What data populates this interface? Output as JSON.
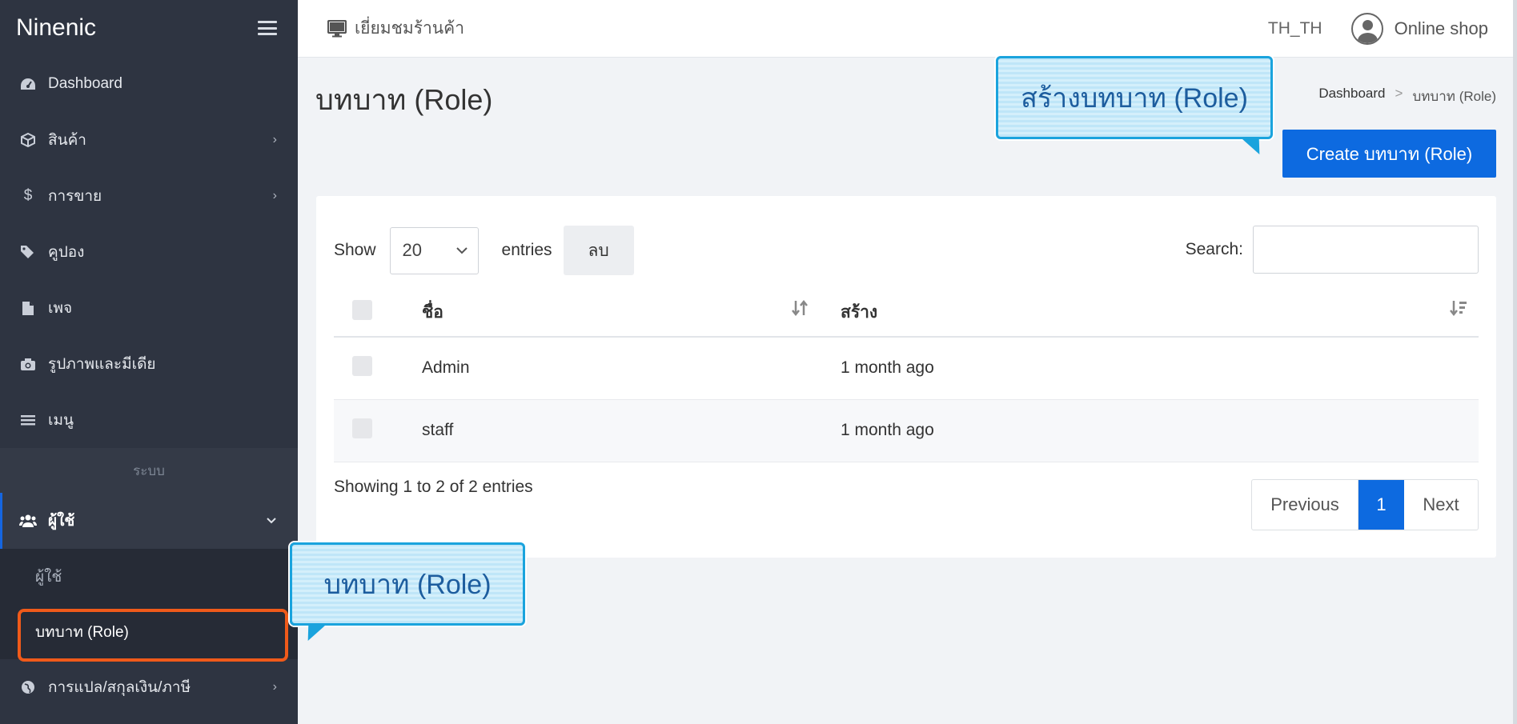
{
  "brand": "Ninenic",
  "sidebar": {
    "items": [
      {
        "label": "Dashboard",
        "icon": "dashboard-icon"
      },
      {
        "label": "สินค้า",
        "icon": "box-icon"
      },
      {
        "label": "การขาย",
        "icon": "dollar-icon"
      },
      {
        "label": "คูปอง",
        "icon": "tags-icon"
      },
      {
        "label": "เพจ",
        "icon": "file-icon"
      },
      {
        "label": "รูปภาพและมีเดีย",
        "icon": "camera-icon"
      },
      {
        "label": "เมนู",
        "icon": "list-icon"
      }
    ],
    "section_label": "ระบบ",
    "users": {
      "label": "ผู้ใช้",
      "icon": "users-icon"
    },
    "sub_items": [
      {
        "label": "ผู้ใช้"
      },
      {
        "label": "บทบาท (Role)"
      }
    ],
    "translation": {
      "label": "การแปล/สกุลเงิน/ภาษี",
      "icon": "globe-icon"
    }
  },
  "topbar": {
    "visit_store": "เยี่ยมชมร้านค้า",
    "language": "TH_TH",
    "user_name": "Online shop"
  },
  "page": {
    "title": "บทบาท (Role)",
    "breadcrumb": [
      "Dashboard",
      ">",
      "บทบาท (Role)"
    ],
    "create_button": "Create บทบาท (Role)"
  },
  "table_controls": {
    "show_label": "Show",
    "entries_value": "20",
    "entries_label": "entries",
    "delete_label": "ลบ",
    "search_label": "Search:",
    "search_value": ""
  },
  "table": {
    "columns": [
      "ชื่อ",
      "สร้าง"
    ],
    "rows": [
      {
        "name": "Admin",
        "created": "1 month ago"
      },
      {
        "name": "staff",
        "created": "1 month ago"
      }
    ]
  },
  "footer": {
    "info": "Showing 1 to 2 of 2 entries",
    "previous": "Previous",
    "page": "1",
    "next": "Next"
  },
  "callouts": {
    "top": "สร้างบทบาท (Role)",
    "bottom": "บทบาท (Role)"
  },
  "colors": {
    "sidebar_bg": "#2e3441",
    "primary": "#0d6ae0",
    "highlight_border": "#f05a1a",
    "callout_border": "#1aa3dd"
  }
}
